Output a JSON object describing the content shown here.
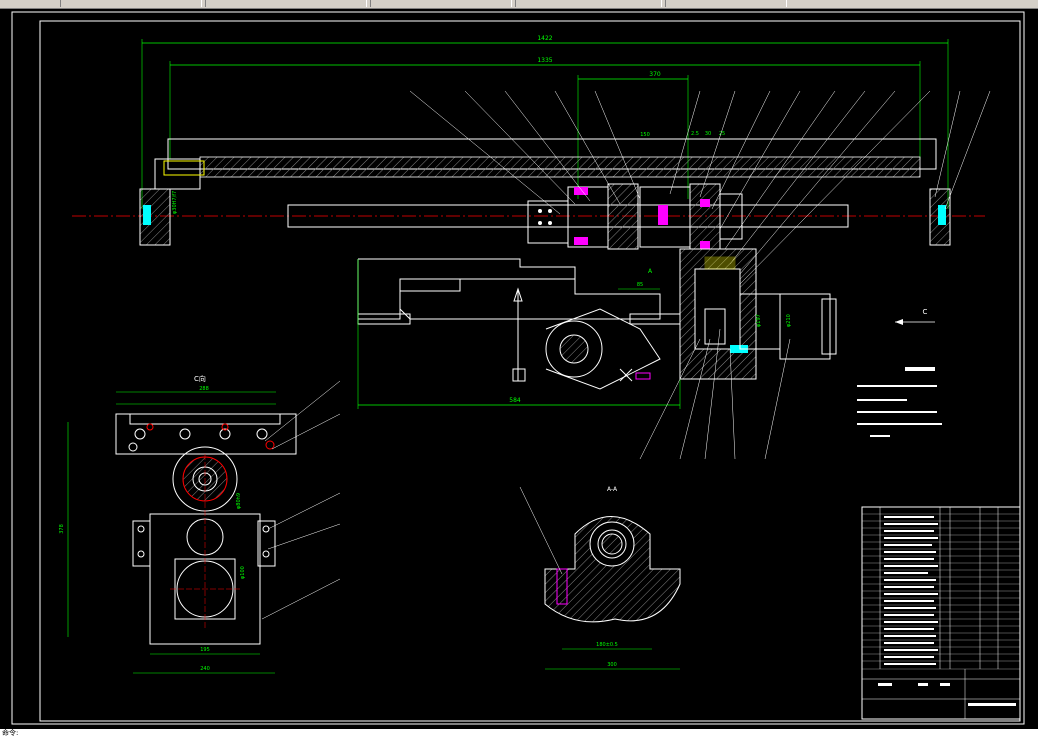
{
  "colors": {
    "background": "#000000",
    "outline": "#ffffff",
    "dimension": "#00ff00",
    "centerline": "#ff0000",
    "leader": "#ffffff",
    "hatch": "#00ffff",
    "bolt": "#ff00ff",
    "block": "#ffff00"
  },
  "dimensions": {
    "overall_length": "1422",
    "rail_length": "1335",
    "span_top": "370",
    "span_150": "150",
    "span_2_5": "2.5",
    "span_30": "30",
    "span_25": "25",
    "carriage_width": "584",
    "offset_85": "85",
    "c_view_top": "288",
    "c_view_width_bottom": "240",
    "c_view_inner": "195",
    "c_view_height": "378",
    "aa_width": "300",
    "aa_inner": "180±0.5"
  },
  "labels": {
    "view_c": "C向",
    "section_aa": "A-A",
    "arrow_c": "C",
    "mark_a": "A"
  },
  "cmdline_text": "命令:"
}
